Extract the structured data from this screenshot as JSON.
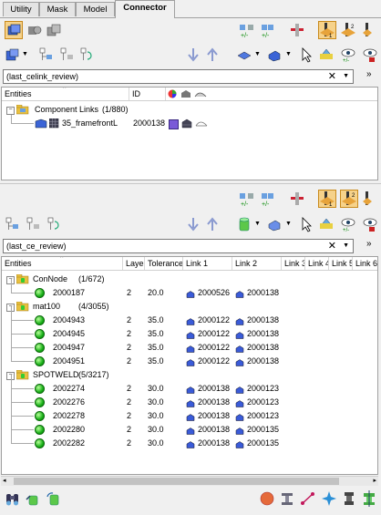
{
  "tabs": [
    {
      "label": "Utility"
    },
    {
      "label": "Mask"
    },
    {
      "label": "Model"
    },
    {
      "label": "Connector"
    }
  ],
  "top_panel": {
    "filter_value": "(last_celink_review)",
    "columns": {
      "entities": "Entities",
      "id": "ID"
    },
    "group": {
      "label": "Component Links",
      "count": "(1/880)"
    },
    "items": [
      {
        "name": "35_framefrontL",
        "id": "2000138"
      }
    ]
  },
  "bottom_panel": {
    "filter_value": "(last_ce_review)",
    "columns": {
      "entities": "Entities",
      "layer": "Layer",
      "tolerance": "Tolerance",
      "link1": "Link 1",
      "link2": "Link 2",
      "link3": "Link 3",
      "link4": "Link 4",
      "link5": "Link 5",
      "link6": "Link 6"
    },
    "groups": [
      {
        "label": "ConNode",
        "count": "(1/672)",
        "rows": [
          {
            "id": "2000187",
            "layer": "2",
            "tolerance": "20.0",
            "link1": "2000526",
            "link2": "2000138"
          }
        ]
      },
      {
        "label": "mat100",
        "count": "(4/3055)",
        "rows": [
          {
            "id": "2004943",
            "layer": "2",
            "tolerance": "35.0",
            "link1": "2000122",
            "link2": "2000138"
          },
          {
            "id": "2004945",
            "layer": "2",
            "tolerance": "35.0",
            "link1": "2000122",
            "link2": "2000138"
          },
          {
            "id": "2004947",
            "layer": "2",
            "tolerance": "35.0",
            "link1": "2000122",
            "link2": "2000138"
          },
          {
            "id": "2004951",
            "layer": "2",
            "tolerance": "35.0",
            "link1": "2000122",
            "link2": "2000138"
          }
        ]
      },
      {
        "label": "SPOTWELD",
        "count": "(5/3217)",
        "rows": [
          {
            "id": "2002274",
            "layer": "2",
            "tolerance": "30.0",
            "link1": "2000138",
            "link2": "2000123"
          },
          {
            "id": "2002276",
            "layer": "2",
            "tolerance": "30.0",
            "link1": "2000138",
            "link2": "2000123"
          },
          {
            "id": "2002278",
            "layer": "2",
            "tolerance": "30.0",
            "link1": "2000138",
            "link2": "2000123"
          },
          {
            "id": "2002280",
            "layer": "2",
            "tolerance": "30.0",
            "link1": "2000138",
            "link2": "2000135"
          },
          {
            "id": "2002282",
            "layer": "2",
            "tolerance": "30.0",
            "link1": "2000138",
            "link2": "2000135"
          }
        ]
      }
    ]
  },
  "icons": {
    "close": "close-icon",
    "dropdown": "chevron-down-icon",
    "more": "double-chevron-icon"
  },
  "colors": {
    "pressed_bg": "#f6d28a",
    "selection_blue": "#3a5bd8",
    "folder_yellow": "#e8c040",
    "green_dot": "#18b018"
  }
}
